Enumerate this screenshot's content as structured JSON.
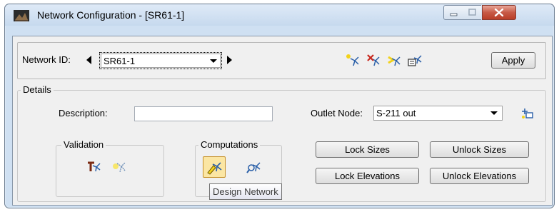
{
  "window": {
    "title": "Network Configuration - [SR61-1]"
  },
  "caption_buttons": {
    "minimize_icon": "minimize-icon",
    "maximize_icon": "maximize-icon",
    "close_icon": "close-icon"
  },
  "network": {
    "id_label": "Network ID:",
    "id_value": "SR61-1",
    "apply_label": "Apply"
  },
  "details": {
    "group_label": "Details",
    "description_label": "Description:",
    "description_value": "",
    "outlet_label": "Outlet Node:",
    "outlet_value": "S-211 out"
  },
  "validation": {
    "group_label": "Validation"
  },
  "computations": {
    "group_label": "Computations"
  },
  "buttons": {
    "lock_sizes": "Lock Sizes",
    "unlock_sizes": "Unlock Sizes",
    "lock_elevations": "Lock Elevations",
    "unlock_elevations": "Unlock Elevations"
  },
  "tooltip": {
    "text": "Design Network"
  },
  "colors": {
    "accent_yellow": "#f2d21b",
    "icon_blue": "#2a5fa8",
    "icon_red": "#c8281e"
  }
}
